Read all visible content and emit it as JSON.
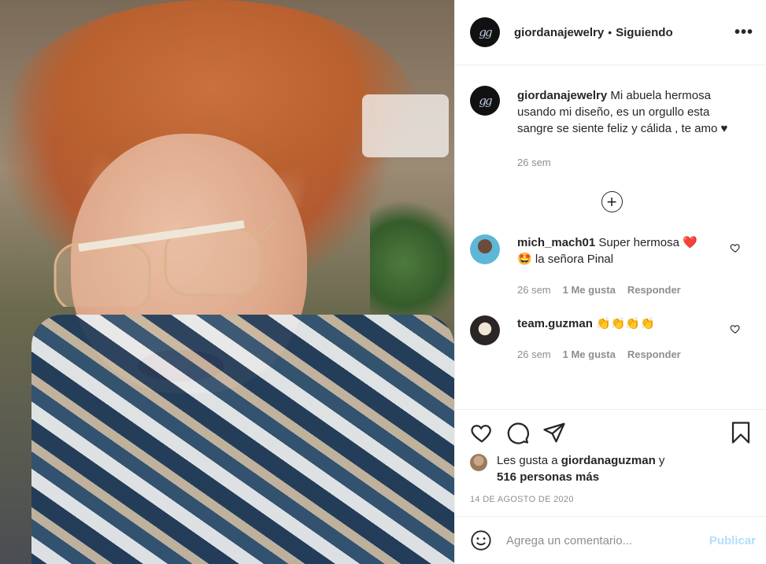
{
  "post": {
    "image_alt": "Fotografía de la publicación",
    "account": "giordanajewelry",
    "avatar_glyph": "gg",
    "follow_status": "Siguiendo",
    "more_label": "•••"
  },
  "caption": {
    "user": "giordanajewelry",
    "text": "Mi abuela hermosa usando mi diseño, es un orgullo esta sangre se siente feliz y cálida , te amo ♥",
    "time": "26 sem"
  },
  "load_more_label": "+",
  "comments": [
    {
      "user": "mich_mach01",
      "text_a": "Super hermosa",
      "emoji_a": "❤️",
      "emoji_b": "🤩",
      "text_b": "la señora Pinal",
      "time": "26 sem",
      "likes": "1 Me gusta",
      "reply": "Responder"
    },
    {
      "user": "team.guzman",
      "emoji": "👏👏👏👏",
      "time": "26 sem",
      "likes": "1 Me gusta",
      "reply": "Responder"
    }
  ],
  "likes": {
    "prefix": "Les gusta a",
    "user": "giordanaguzman",
    "conj": "y",
    "others": "516 personas más"
  },
  "date": "14 DE AGOSTO DE 2020",
  "add_comment": {
    "placeholder": "Agrega un comentario...",
    "publish": "Publicar"
  },
  "colors": {
    "text": "#262626",
    "muted": "#8e8e8e",
    "publish_disabled": "#b2dffc",
    "heart": "#ed4956"
  },
  "icons": [
    "heart-icon",
    "comment-icon",
    "share-icon",
    "bookmark-icon",
    "emoji-icon",
    "plus-circle-icon",
    "more-icon"
  ]
}
